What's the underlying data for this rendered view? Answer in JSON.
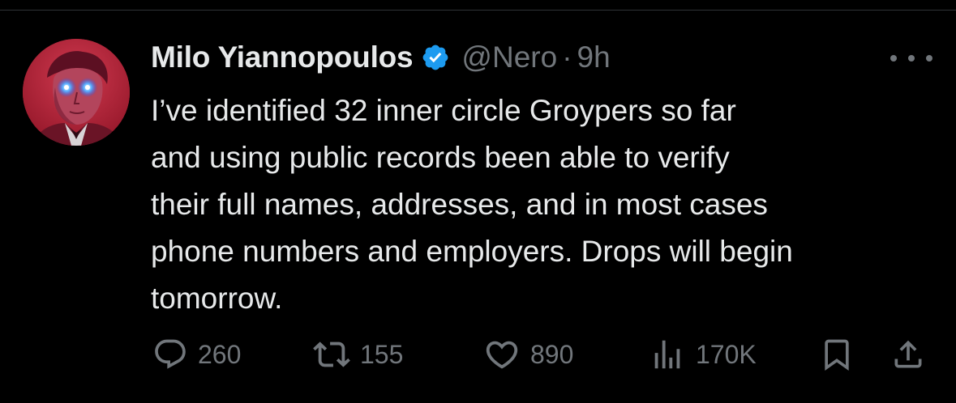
{
  "tweet": {
    "author": {
      "display_name": "Milo Yiannopoulos",
      "handle": "@Nero",
      "verified": true
    },
    "separator": "·",
    "time_ago": "9h",
    "text_lines": [
      "I’ve identified 32 inner circle Groypers so far",
      "and using public records been able to verify",
      "their full names, addresses, and in most cases",
      "phone numbers and employers. Drops will begin",
      "tomorrow."
    ],
    "actions": {
      "replies": "260",
      "reposts": "155",
      "likes": "890",
      "views": "170K"
    }
  },
  "colors": {
    "background": "#000000",
    "text_primary": "#e7e9ea",
    "text_secondary": "#71767b",
    "verified_blue": "#1d9bf0",
    "divider": "#2f3336"
  },
  "icons": {
    "verified": "verified-badge-icon",
    "more": "more-icon",
    "reply": "reply-icon",
    "repost": "repost-icon",
    "like": "heart-icon",
    "views": "views-icon",
    "bookmark": "bookmark-icon",
    "share": "share-icon"
  }
}
